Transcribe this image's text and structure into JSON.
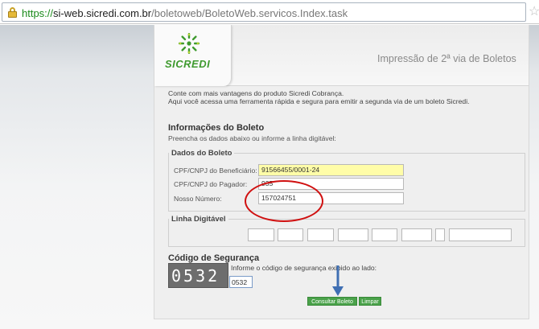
{
  "browser": {
    "url_protocol": "https://",
    "url_domain": "si-web.sicredi.com.br",
    "url_path": "/boletoweb/BoletoWeb.servicos.Index.task"
  },
  "header": {
    "logo_text": "SICREDI",
    "title": "Impressão de 2ª via de Boletos"
  },
  "intro": {
    "line1": "Conte com mais vantagens do produto Sicredi Cobrança.",
    "line2": "Aqui você acessa uma ferramenta rápida e segura para emitir a segunda via de um boleto Sicredi."
  },
  "info": {
    "title": "Informações do Boleto",
    "subtitle": "Preencha os dados abaixo ou informe a linha digitável:"
  },
  "dados": {
    "legend": "Dados do Boleto",
    "fields": [
      {
        "label": "CPF/CNPJ do Beneficiário:",
        "value": "91566455/0001-24"
      },
      {
        "label": "CPF/CNPJ do Pagador:",
        "value": "935"
      },
      {
        "label": "Nosso Número:",
        "value": "157024751"
      }
    ]
  },
  "linha": {
    "legend": "Linha Digitável"
  },
  "seguranca": {
    "title": "Código de Segurança",
    "captcha": "0532",
    "info": "Informe o código de segurança exibido ao lado:",
    "value": "0532"
  },
  "buttons": {
    "consultar": "Consultar Boleto",
    "limpar": "Limpar"
  },
  "colors": {
    "brand_green": "#3e9a2e",
    "highlight_field": "#fffda8",
    "annotation": "#d01010",
    "arrow": "#3f6fb3"
  },
  "icons": [
    "lock-icon",
    "bookmark-star-icon",
    "sicredi-logo-icon",
    "down-arrow-icon"
  ]
}
